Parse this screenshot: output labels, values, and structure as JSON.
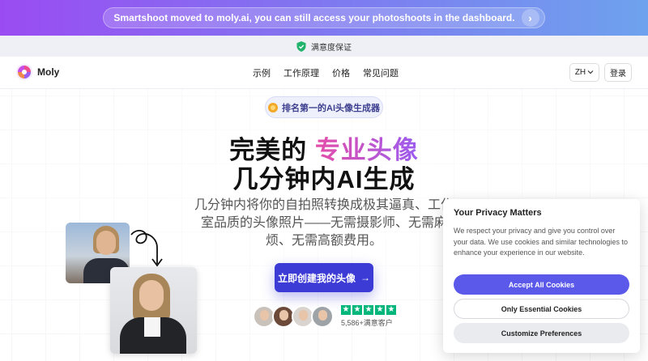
{
  "banner": {
    "text": "Smartshoot moved to moly.ai, you can still access your photoshoots in the dashboard.",
    "arrow": "›"
  },
  "guarantee": {
    "text": "满意度保证"
  },
  "nav": {
    "brand": "Moly",
    "menu": [
      "示例",
      "工作原理",
      "价格",
      "常见问题"
    ],
    "language": "ZH",
    "login": "登录"
  },
  "hero": {
    "badge": "排名第一的AI头像生成器",
    "headline_plain": "完美的 ",
    "headline_highlight": "专业头像",
    "headline_line2": "几分钟内AI生成",
    "subtitle": "几分钟内将你的自拍照转换成极其逼真、工作室品质的头像照片——无需摄影师、无需麻烦、无需高额费用。",
    "cta_label": "立即创建我的头像",
    "cta_arrow": "→",
    "customers": "5,586+满意客户",
    "star_glyph": "★"
  },
  "cookie": {
    "title": "Your Privacy Matters",
    "text": "We respect your privacy and give you control over your data. We use cookies and similar technologies to enhance your experience in our website.",
    "accept": "Accept All Cookies",
    "essential": "Only Essential Cookies",
    "customize": "Customize Preferences"
  },
  "colors": {
    "accent": "#3d3bd6",
    "cookie_primary": "#5b59ea",
    "banner_start": "#9a4cf2",
    "banner_end": "#6ea2ee",
    "trustpilot": "#00b67a"
  },
  "icons": [
    "shield-check-icon",
    "moly-logo-icon",
    "chevron-down-icon",
    "sparkle-badge-icon",
    "arrow-right-icon",
    "curved-arrow-icon",
    "star-icon"
  ]
}
